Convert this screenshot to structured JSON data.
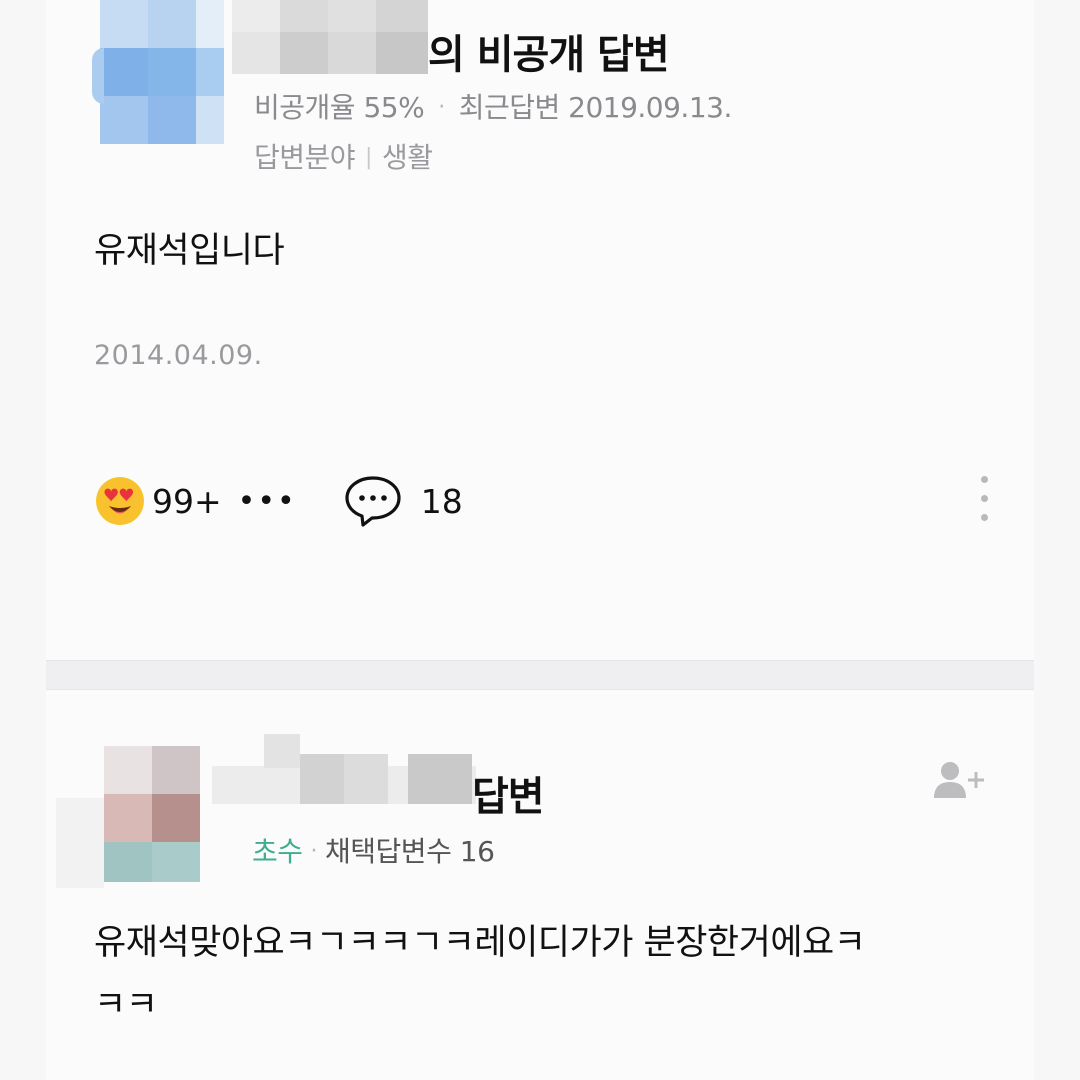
{
  "first_answer": {
    "title_suffix": "의 비공개 답변",
    "private_rate_label": "비공개율",
    "private_rate_value": "55%",
    "recent_answer_label": "최근답변",
    "recent_answer_date": "2019.09.13.",
    "field_label": "답변분야",
    "field_value": "생활",
    "content": "유재석입니다",
    "date": "2014.04.09.",
    "reaction_count": "99+",
    "more_reactions": "•••",
    "comment_count": "18",
    "icons": [
      "heart-eyes-emoji-icon",
      "comment-bubble-icon",
      "kebab-menu-icon"
    ]
  },
  "second_answer": {
    "title_suffix": "답변",
    "rank": "초수",
    "adopted_label": "채택답변수",
    "adopted_count": "16",
    "content_line1": "유재석맞아요ㅋㄱㅋㅋㄱㅋ레이디가가 분장한거에요ㅋ",
    "content_line2": "ㅋㅋ",
    "icons": [
      "add-friend-icon"
    ]
  },
  "colors": {
    "rank_green": "#3fae8f",
    "emoji_yellow": "#f7c52b",
    "meta_gray": "#8a8a8e"
  }
}
